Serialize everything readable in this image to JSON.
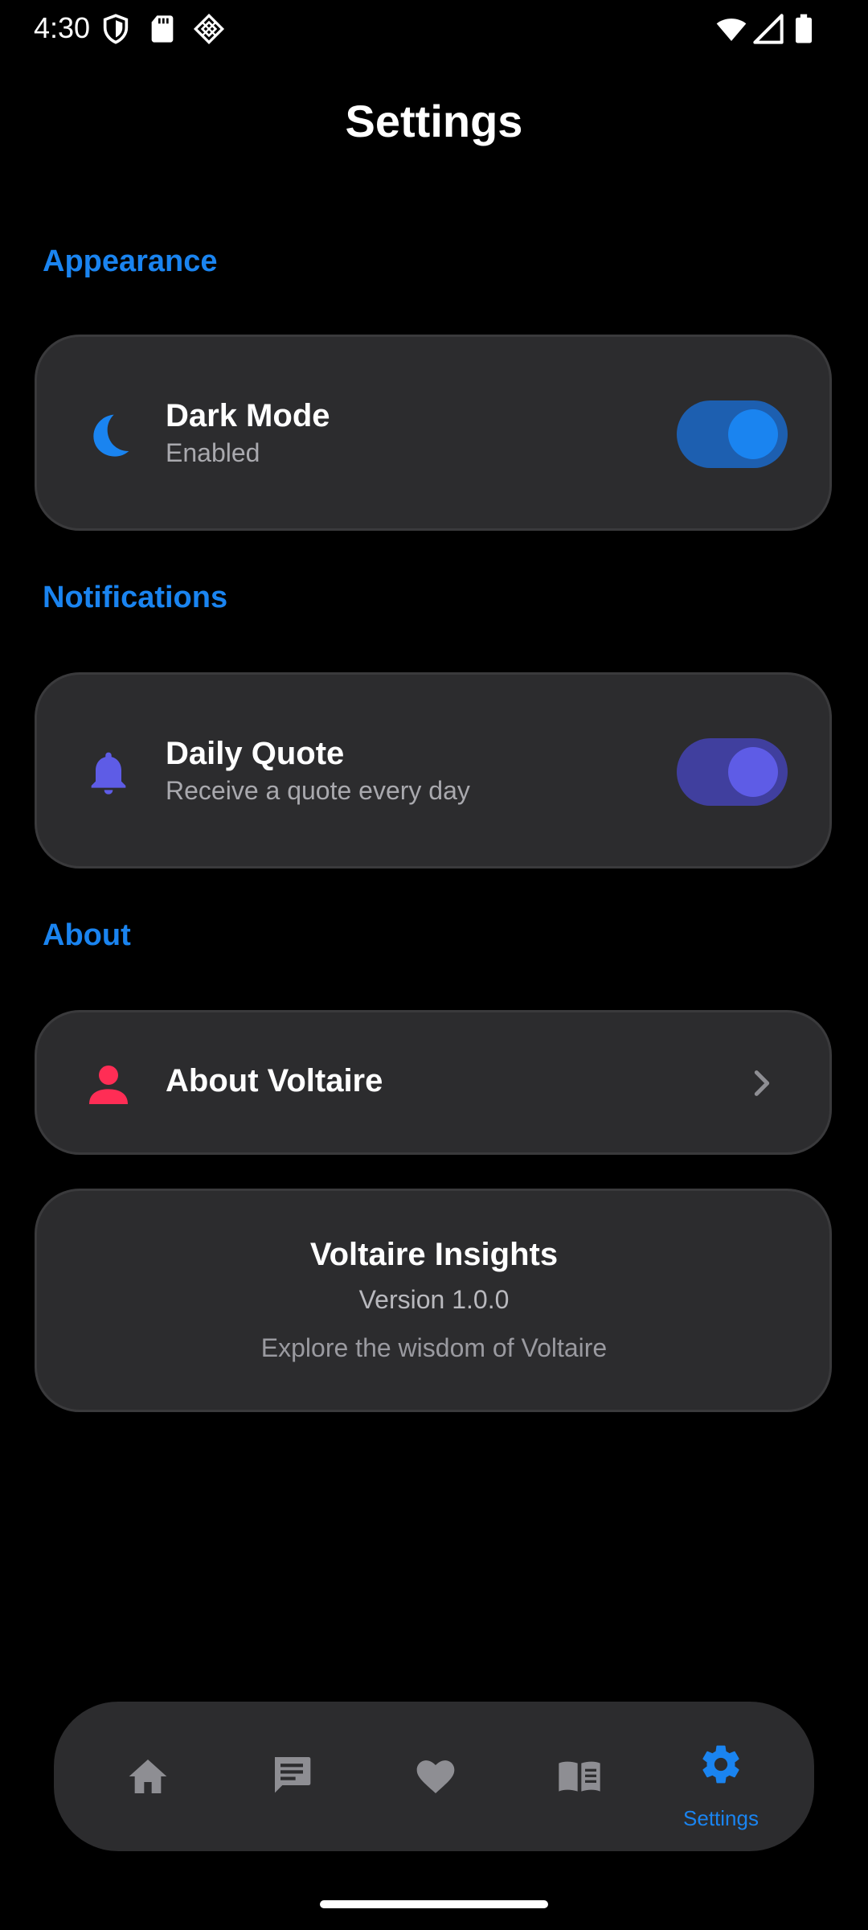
{
  "status_bar": {
    "time": "4:30"
  },
  "page": {
    "title": "Settings"
  },
  "sections": {
    "appearance": "Appearance",
    "notifications": "Notifications",
    "about": "About"
  },
  "dark_mode": {
    "title": "Dark Mode",
    "subtitle": "Enabled",
    "on": true,
    "icon": "moon-icon",
    "icon_color": "#1a84f0",
    "track_color": "#1d5fb0",
    "knob_color": "#1a84f0"
  },
  "daily_quote": {
    "title": "Daily Quote",
    "subtitle": "Receive a quote every day",
    "on": true,
    "icon": "bell-icon",
    "icon_color": "#5e5ce6",
    "track_color": "#403f9e",
    "knob_color": "#5e5ce6"
  },
  "about_voltaire": {
    "title": "About Voltaire",
    "icon": "person-icon",
    "icon_color": "#ff2d55"
  },
  "app_info": {
    "name": "Voltaire Insights",
    "version": "Version 1.0.0",
    "tagline": "Explore the wisdom of Voltaire"
  },
  "bottom_nav": {
    "items": [
      {
        "icon": "home-icon",
        "label": "",
        "active": false
      },
      {
        "icon": "quotes-icon",
        "label": "",
        "active": false
      },
      {
        "icon": "heart-icon",
        "label": "",
        "active": false
      },
      {
        "icon": "book-icon",
        "label": "",
        "active": false
      },
      {
        "icon": "gear-icon",
        "label": "Settings",
        "active": true
      }
    ],
    "active_color": "#1a84f0",
    "inactive_color": "#8e8e93"
  }
}
